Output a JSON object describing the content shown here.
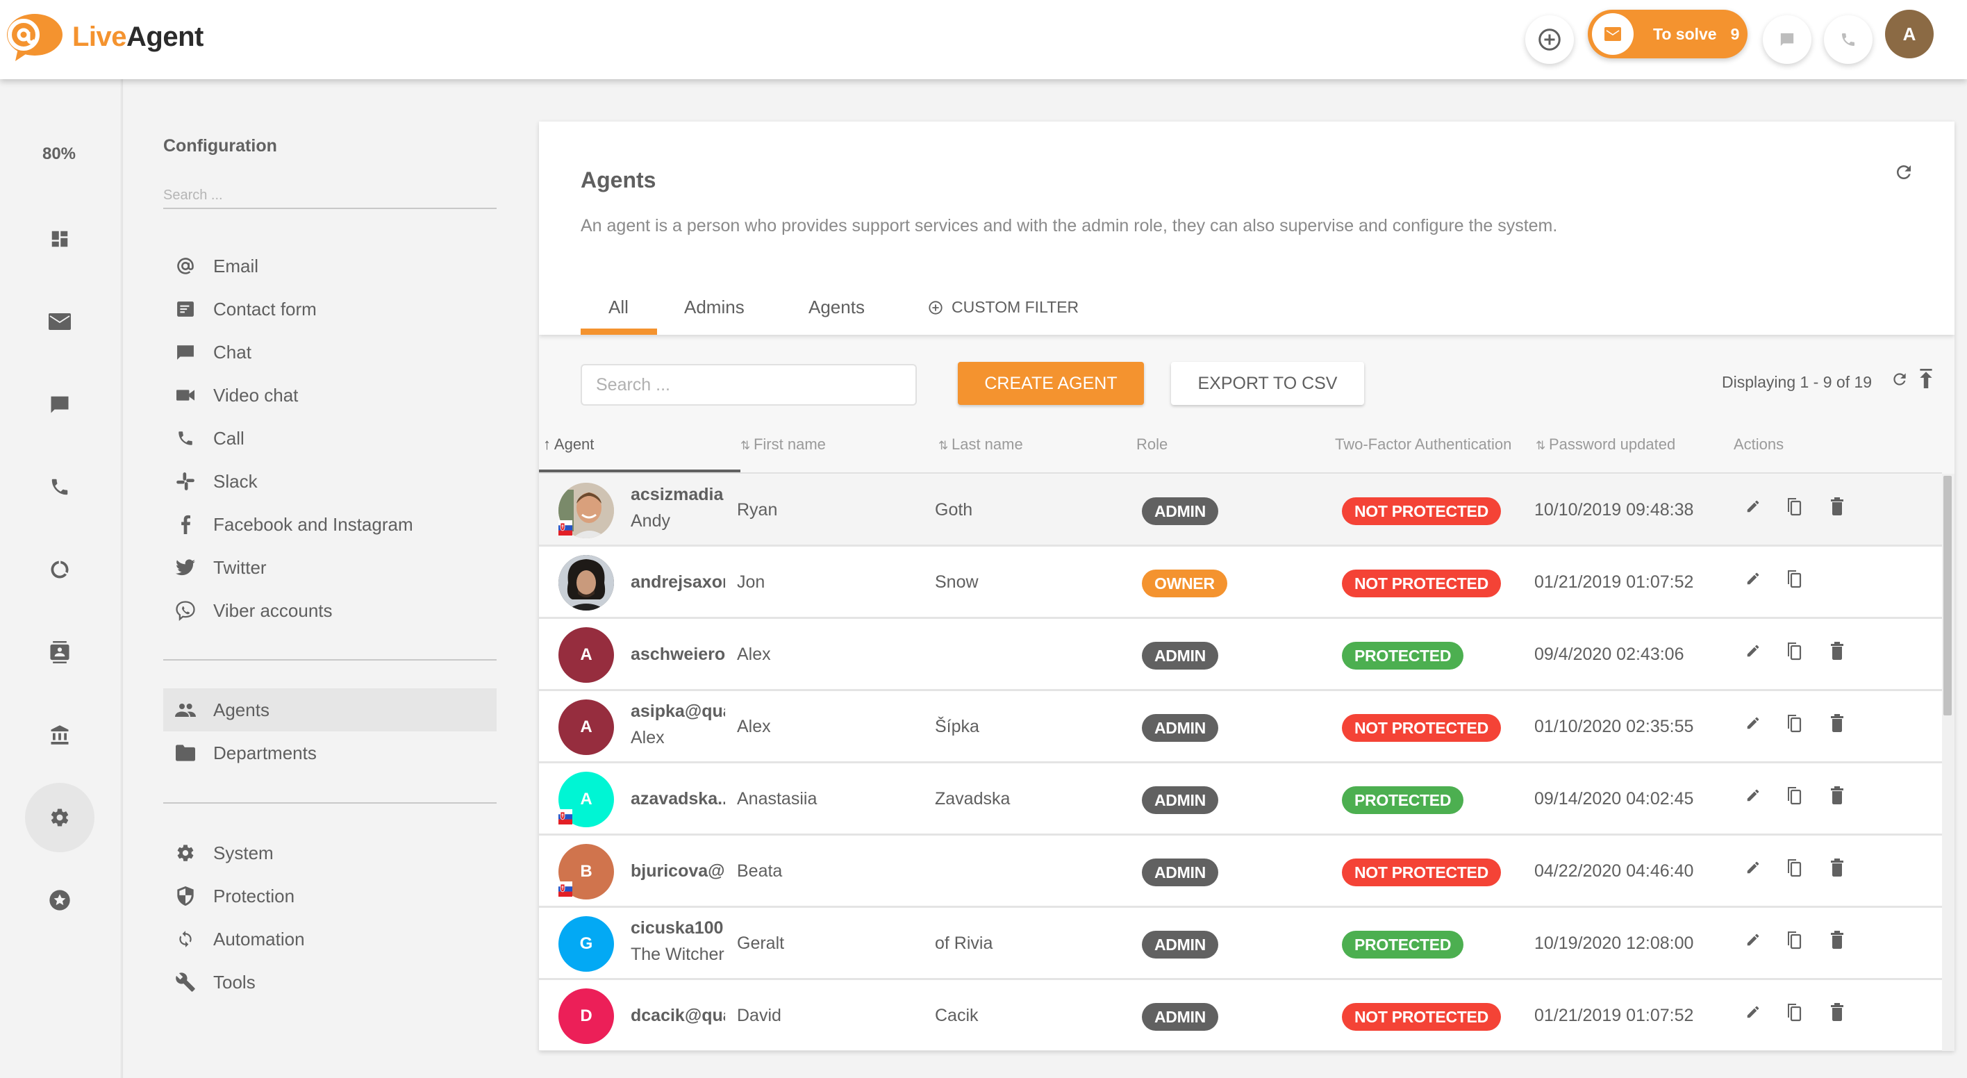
{
  "header": {
    "logo_live": "Live",
    "logo_agent": "Agent",
    "to_solve_label": "To solve",
    "to_solve_count": "9",
    "user_initial": "A",
    "icons": [
      "add-circle-icon",
      "mail-icon",
      "chat-icon",
      "phone-icon"
    ]
  },
  "rail": {
    "percent": "80%",
    "items": [
      "dashboard",
      "tickets",
      "chats",
      "calls",
      "reports",
      "contacts",
      "knowledgebase",
      "configuration",
      "plugins"
    ],
    "active": "configuration"
  },
  "config": {
    "title": "Configuration",
    "search_placeholder": "Search ...",
    "group1": [
      {
        "label": "Email",
        "icon": "at-icon"
      },
      {
        "label": "Contact form",
        "icon": "contact-form-icon"
      },
      {
        "label": "Chat",
        "icon": "chat-icon"
      },
      {
        "label": "Video chat",
        "icon": "video-icon"
      },
      {
        "label": "Call",
        "icon": "phone-icon"
      },
      {
        "label": "Slack",
        "icon": "slack-icon"
      },
      {
        "label": "Facebook and Instagram",
        "icon": "facebook-icon"
      },
      {
        "label": "Twitter",
        "icon": "twitter-icon"
      },
      {
        "label": "Viber accounts",
        "icon": "viber-icon"
      }
    ],
    "group2": [
      {
        "label": "Agents",
        "icon": "people-icon",
        "active": true
      },
      {
        "label": "Departments",
        "icon": "folder-icon"
      }
    ],
    "group3": [
      {
        "label": "System",
        "icon": "gear-icon"
      },
      {
        "label": "Protection",
        "icon": "shield-icon"
      },
      {
        "label": "Automation",
        "icon": "sync-icon"
      },
      {
        "label": "Tools",
        "icon": "wrench-icon"
      }
    ]
  },
  "main": {
    "title": "Agents",
    "description": "An agent is a person who provides support services and with the admin role, they can also supervise and configure the system.",
    "tabs": [
      {
        "label": "All",
        "active": true
      },
      {
        "label": "Admins"
      },
      {
        "label": "Agents"
      },
      {
        "label": "CUSTOM FILTER"
      }
    ],
    "search_placeholder": "Search ...",
    "create_label": "CREATE AGENT",
    "export_label": "EXPORT TO CSV",
    "displaying": "Displaying 1 - 9 of 19",
    "columns": [
      "Agent",
      "First name",
      "Last name",
      "Role",
      "Two-Factor Authentication",
      "Password updated",
      "Actions"
    ],
    "sorted_column": "Agent",
    "rows": [
      {
        "login": "acsizmadia",
        "sub": "Andy",
        "first": "Ryan",
        "last": "Goth",
        "role": "ADMIN",
        "tfa": "NOT PROTECTED",
        "pwd": "10/10/2019 09:48:38",
        "avatar": "photo",
        "avatar_color": "#d9c7b0",
        "initial": "",
        "flag": true,
        "delete": true,
        "hover": true
      },
      {
        "login": "andrejsaxon",
        "sub": "",
        "first": "Jon",
        "last": "Snow",
        "role": "OWNER",
        "tfa": "NOT PROTECTED",
        "pwd": "01/21/2019 01:07:52",
        "avatar": "photo",
        "avatar_color": "#3a3a3a",
        "initial": "",
        "flag": false,
        "delete": false
      },
      {
        "login": "aschweiero",
        "sub": "",
        "first": "Alex",
        "last": "",
        "role": "ADMIN",
        "tfa": "PROTECTED",
        "pwd": "09/4/2020 02:43:06",
        "avatar": "initial",
        "avatar_color": "#962d3e",
        "initial": "A",
        "flag": false,
        "delete": true
      },
      {
        "login": "asipka@qua",
        "sub": "Alex",
        "first": "Alex",
        "last": "Šípka",
        "role": "ADMIN",
        "tfa": "NOT PROTECTED",
        "pwd": "01/10/2020 02:35:55",
        "avatar": "initial",
        "avatar_color": "#962d3e",
        "initial": "A",
        "flag": false,
        "delete": true
      },
      {
        "login": "azavadska...",
        "sub": "",
        "first": "Anastasiia",
        "last": "Zavadska",
        "role": "ADMIN",
        "tfa": "PROTECTED",
        "pwd": "09/14/2020 04:02:45",
        "avatar": "initial",
        "avatar_color": "#00f5d4",
        "initial": "A",
        "flag": true,
        "delete": true
      },
      {
        "login": "bjuricova@...",
        "sub": "",
        "first": "Beata",
        "last": "",
        "role": "ADMIN",
        "tfa": "NOT PROTECTED",
        "pwd": "04/22/2020 04:46:40",
        "avatar": "initial",
        "avatar_color": "#d0744d",
        "initial": "B",
        "flag": true,
        "delete": true
      },
      {
        "login": "cicuska100",
        "sub": "The Witcher",
        "first": "Geralt",
        "last": "of Rivia",
        "role": "ADMIN",
        "tfa": "PROTECTED",
        "pwd": "10/19/2020 12:08:00",
        "avatar": "initial",
        "avatar_color": "#03a9f4",
        "initial": "G",
        "flag": false,
        "delete": true
      },
      {
        "login": "dcacik@qua",
        "sub": "",
        "first": "David",
        "last": "Cacik",
        "role": "ADMIN",
        "tfa": "NOT PROTECTED",
        "pwd": "01/21/2019 01:07:52",
        "avatar": "initial",
        "avatar_color": "#ec1f58",
        "initial": "D",
        "flag": false,
        "delete": true
      }
    ]
  },
  "colors": {
    "accent": "#f4932f",
    "admin_badge": "#616161",
    "owner_badge": "#f4932f",
    "not_protected": "#f44336",
    "protected": "#4caf50",
    "text": "#616161"
  }
}
